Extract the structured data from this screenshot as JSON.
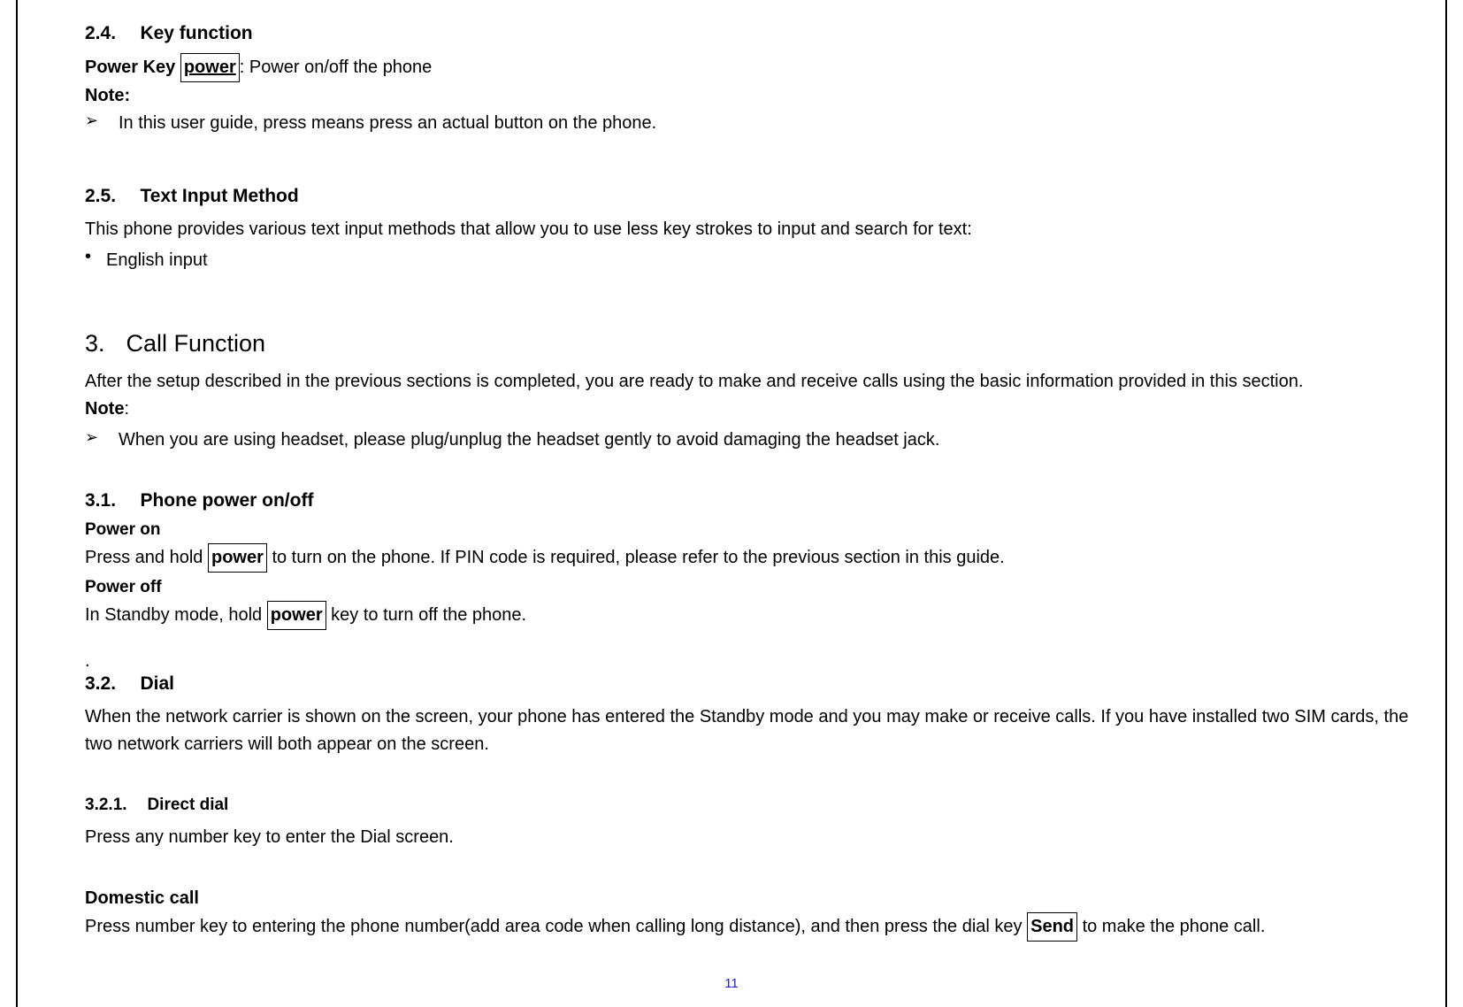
{
  "s24": {
    "num": "2.4.",
    "title": "Key function",
    "power_key_label": "Power Key ",
    "power_box": "power",
    "power_desc": ": Power on/off the phone",
    "note": "Note:",
    "bullet1": "In this user guide, press means press an actual button on the phone."
  },
  "s25": {
    "num": "2.5.",
    "title": "Text Input Method",
    "body": "This phone provides various text input methods that allow you to use less key strokes to input and search for text:",
    "bullet1": "English input"
  },
  "s3": {
    "num": "3.",
    "title": "Call  Function",
    "body": "After the setup described in the previous sections is completed, you are ready to make and receive calls using the basic information provided in this section.",
    "note": "Note",
    "note_colon": ":",
    "bullet1": "When you are using headset, please plug/unplug the headset gently to avoid damaging the headset jack."
  },
  "s31": {
    "num": "3.1.",
    "title": "Phone power on/off",
    "power_on_label": "Power on",
    "power_on_pre": "Press and hold ",
    "power_box": "power",
    "power_on_post": " to turn on the phone. If PIN code is required, please refer to the previous section in this guide.",
    "power_off_label": "Power off",
    "power_off_pre": "In Standby mode, hold ",
    "power_off_post": " key to turn off the phone."
  },
  "lone_dot": ".",
  "s32": {
    "num": "3.2.",
    "title": "Dial",
    "body": "When the network carrier is shown on the screen, your phone has entered the Standby mode and you may make or receive calls. If you have installed two SIM cards, the two network carriers will both appear on the screen."
  },
  "s321": {
    "num": "3.2.1.",
    "title": "Direct dial",
    "body": "Press any number key to enter the Dial screen."
  },
  "domestic": {
    "label": "Domestic call",
    "pre": "Press number key to entering the phone number(add area code when calling long distance), and then press the dial key ",
    "send_box": "Send",
    "post": " to make the phone call."
  },
  "page_number": "11"
}
